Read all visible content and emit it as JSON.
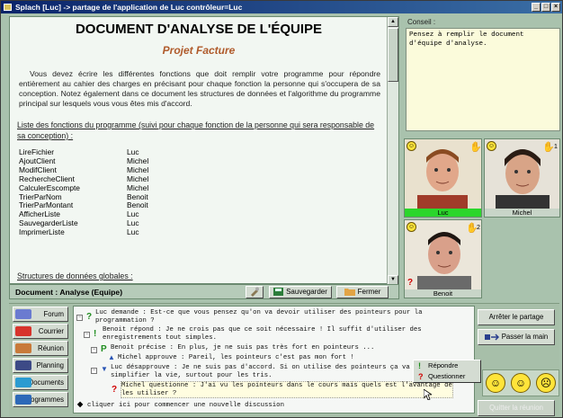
{
  "window": {
    "title": "Splach [Luc] -> partage de l'application de Luc contrôleur=Luc"
  },
  "document": {
    "title": "DOCUMENT D'ANALYSE DE L'ÉQUIPE",
    "subtitle": "Projet Facture",
    "paragraph": "Vous devez écrire les différentes fonctions que doit remplir votre programme pour répondre entièrement au cahier des charges en précisant pour chaque fonction la personne qui s'occupera de sa conception. Notez également dans ce document les structures de données et l'algorithme du programme principal sur lesquels vous vous êtes mis d'accord.",
    "functions_heading": "Liste des fonctions du programme (suivi pour chaque fonction de la personne qui sera responsable de sa conception) :",
    "functions": [
      {
        "name": "LireFichier",
        "owner": "Luc"
      },
      {
        "name": "AjoutClient",
        "owner": "Michel"
      },
      {
        "name": "ModifClient",
        "owner": "Michel"
      },
      {
        "name": "RechercheClient",
        "owner": "Michel"
      },
      {
        "name": "CalculerEscompte",
        "owner": "Michel"
      },
      {
        "name": "TrierParNom",
        "owner": "Benoit"
      },
      {
        "name": "TrierParMontant",
        "owner": "Benoit"
      },
      {
        "name": "AfficherListe",
        "owner": "Luc"
      },
      {
        "name": "SauvegarderListe",
        "owner": "Luc"
      },
      {
        "name": "ImprimerListe",
        "owner": "Luc"
      }
    ],
    "structures_heading": "Structures de données globales :"
  },
  "doc_toolbar": {
    "label": "Document : Analyse (Equipe)",
    "save": "Sauvegarder",
    "close": "Fermer"
  },
  "conseil": {
    "label": "Conseil :",
    "text": "Pensez à remplir le document d'équipe d'analyse."
  },
  "participants": [
    {
      "name": "Luc",
      "active": true,
      "hand_number": ""
    },
    {
      "name": "Michel",
      "active": false,
      "hand_number": "1"
    },
    {
      "name": "Benoit",
      "active": false,
      "hand_number": "2"
    }
  ],
  "nav": [
    "Forum",
    "Courrier",
    "Réunion",
    "Planning",
    "Documents",
    "Programmes"
  ],
  "discussion": [
    {
      "mark": "?",
      "text": "Luc demande : Est-ce que vous pensez qu'on va devoir utiliser des pointeurs pour la",
      "text2": "programmation ?"
    },
    {
      "mark": "!",
      "text": "Benoit répond : Je ne crois pas que ce soit nécessaire ! Il suffit d'utiliser des",
      "text2": "enregistrements tout simples."
    },
    {
      "mark": "P",
      "text": "Benoit précise : En plus, je ne suis pas très fort en pointeurs ..."
    },
    {
      "mark": "👍",
      "text": "Michel approuve : Pareil, les pointeurs c'est pas mon fort !"
    },
    {
      "mark": "👎",
      "text": "Luc désapprouve : Je ne suis pas d'accord. Si on utilise des pointeurs ça va",
      "text2": "simplifier la vie, surtout pour les tris."
    },
    {
      "mark": "?",
      "text": "Michel questionne : J'ai vu les pointeurs dans le cours mais quels est l'avantage de",
      "text2": "les utiliser ?"
    },
    {
      "mark": "•",
      "text": "cliquer ici pour commencer une nouvelle discussion"
    }
  ],
  "context_menu": [
    "Répondre",
    "Questionner"
  ],
  "right_buttons": {
    "stop_share": "Arrêter le partage",
    "pass_hand": "Passer la main",
    "disabled": "Quitter la réunion"
  },
  "colors": {
    "background": "#a9c2ad",
    "active": "#2bd62b",
    "accent": "#b05b2c"
  }
}
